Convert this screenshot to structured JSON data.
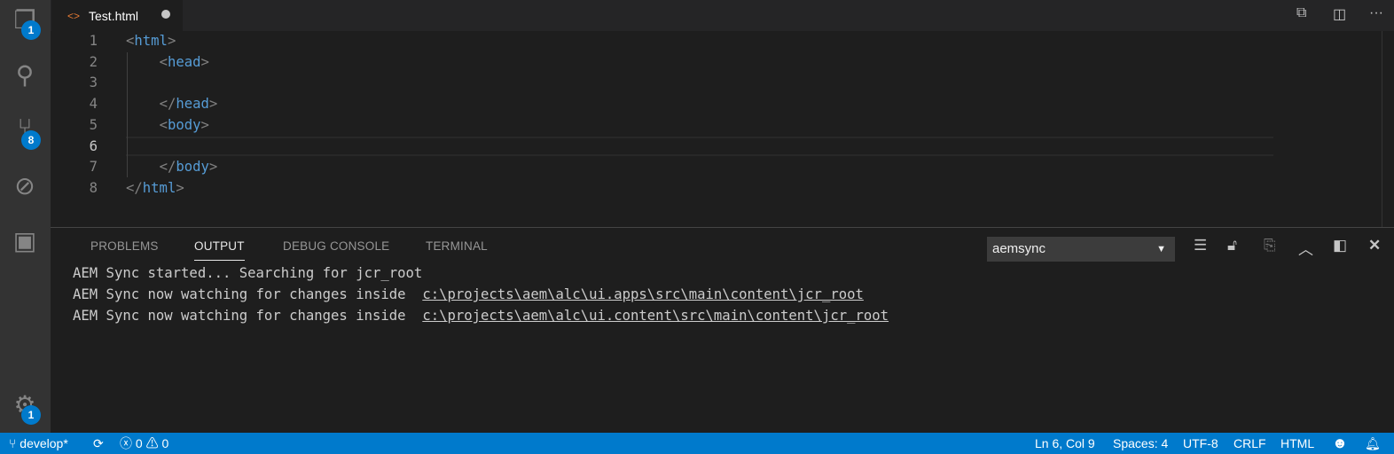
{
  "activity_bar": {
    "explorer_badge": "1",
    "scm_badge": "8",
    "settings_badge": "1"
  },
  "tab": {
    "label": "Test.html"
  },
  "editor": {
    "lines": [
      {
        "num": "1",
        "indent": "",
        "open": "<",
        "tag": "html",
        "close": ">"
      },
      {
        "num": "2",
        "indent": "    ",
        "open": "<",
        "tag": "head",
        "close": ">"
      },
      {
        "num": "3",
        "indent": "",
        "open": "",
        "tag": "",
        "close": ""
      },
      {
        "num": "4",
        "indent": "    ",
        "open": "</",
        "tag": "head",
        "close": ">"
      },
      {
        "num": "5",
        "indent": "    ",
        "open": "<",
        "tag": "body",
        "close": ">"
      },
      {
        "num": "6",
        "indent": "",
        "open": "",
        "tag": "",
        "close": ""
      },
      {
        "num": "7",
        "indent": "    ",
        "open": "</",
        "tag": "body",
        "close": ">"
      },
      {
        "num": "8",
        "indent": "",
        "open": "</",
        "tag": "html",
        "close": ">"
      }
    ]
  },
  "panel": {
    "tabs": [
      "PROBLEMS",
      "OUTPUT",
      "DEBUG CONSOLE",
      "TERMINAL"
    ],
    "channel": "aemsync",
    "output": [
      {
        "text": "AEM Sync started... Searching for jcr_root",
        "link": ""
      },
      {
        "text": "AEM Sync now watching for changes inside  ",
        "link": "c:\\projects\\aem\\alc\\ui.apps\\src\\main\\content\\jcr_root"
      },
      {
        "text": "AEM Sync now watching for changes inside  ",
        "link": "c:\\projects\\aem\\alc\\ui.content\\src\\main\\content\\jcr_root"
      }
    ]
  },
  "status": {
    "branch": "develop*",
    "errors": "0",
    "warnings": "0",
    "position": "Ln 6, Col 9",
    "spaces": "Spaces: 4",
    "encoding": "UTF-8",
    "eol": "CRLF",
    "language": "HTML"
  }
}
